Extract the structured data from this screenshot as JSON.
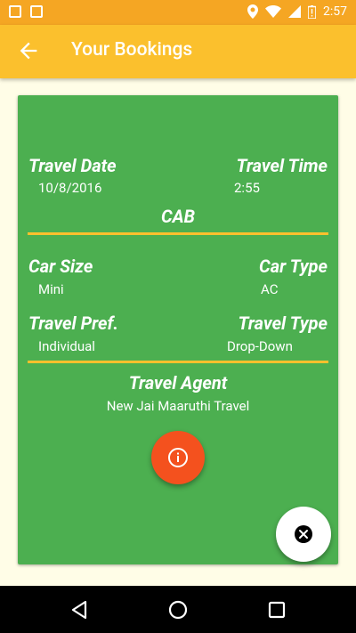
{
  "status_bar": {
    "time": "2:57"
  },
  "app_bar": {
    "title": "Your Bookings"
  },
  "booking": {
    "travel_date_label": "Travel Date",
    "travel_date": "10/8/2016",
    "travel_time_label": "Travel Time",
    "travel_time": "2:55",
    "section_title": "CAB",
    "car_size_label": "Car Size",
    "car_size": "Mini",
    "car_type_label": "Car Type",
    "car_type": "AC",
    "travel_pref_label": "Travel Pref.",
    "travel_pref": "Individual",
    "travel_type_label": "Travel Type",
    "travel_type": "Drop-Down",
    "agent_label": "Travel Agent",
    "agent": "New Jai Maaruthi Travel"
  },
  "colors": {
    "status_bar": "#F5A623",
    "app_bar": "#FBC02D",
    "card": "#4CAF50",
    "divider": "#FBC02D",
    "info_fab": "#F4511E",
    "background": "#FFFDE7"
  },
  "icons": {
    "back": "arrow-left-icon",
    "info": "info-icon",
    "close": "close-circle-icon",
    "nav_back": "triangle-back-icon",
    "nav_home": "circle-home-icon",
    "nav_recents": "square-recents-icon"
  }
}
